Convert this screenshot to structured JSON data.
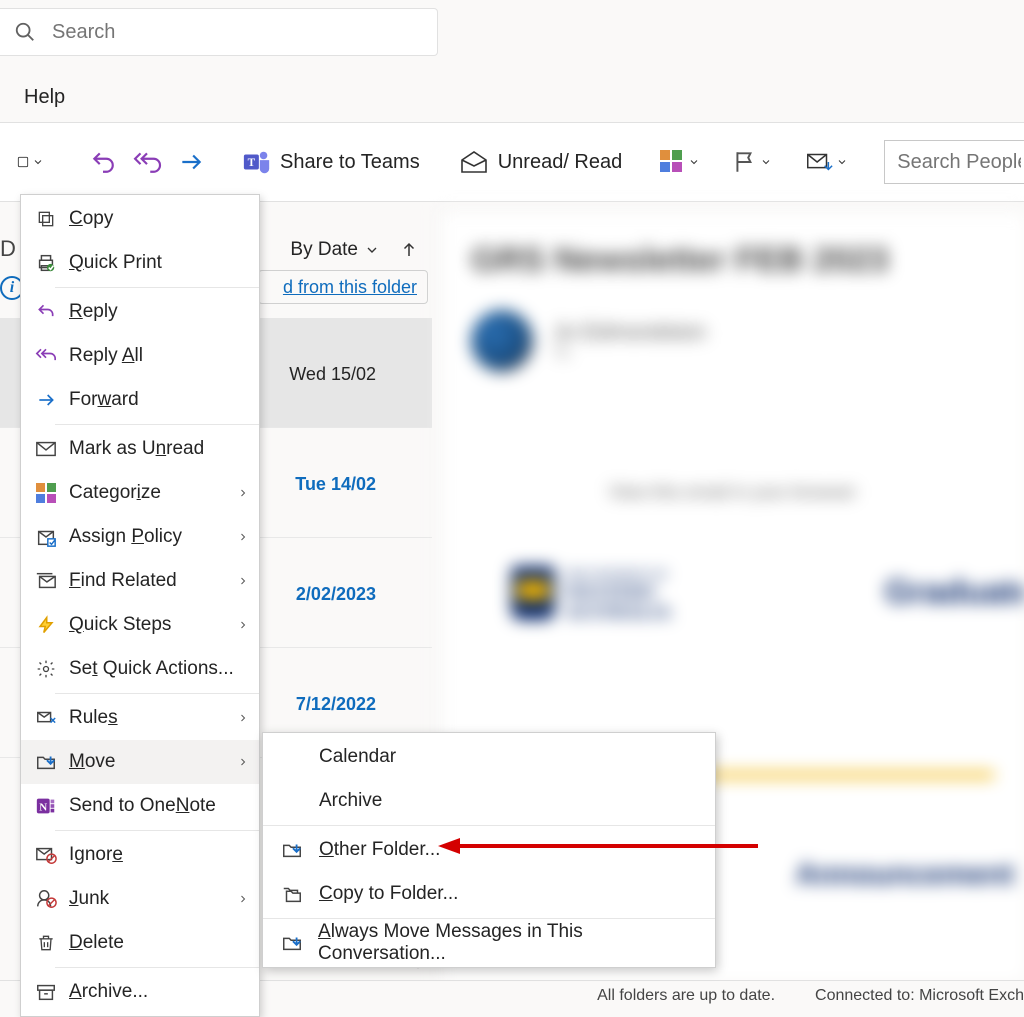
{
  "search": {
    "placeholder": "Search"
  },
  "tabs": {
    "help": "Help"
  },
  "ribbon": {
    "share_to_teams": "Share to Teams",
    "unread_read": "Unread/ Read",
    "search_people_placeholder": "Search People"
  },
  "list_header": {
    "by_date": "By Date",
    "folder_link": "d from this folder"
  },
  "messages": [
    {
      "date": "Wed 15/02",
      "unread": false
    },
    {
      "date": "Tue 14/02",
      "unread": true
    },
    {
      "date": "2/02/2023",
      "unread": true
    },
    {
      "date": "7/12/2022",
      "unread": true
    }
  ],
  "reading": {
    "subject": "GRS Newsletter FEB 2023",
    "from": "Jo Edmondston",
    "to_label": "To",
    "view_in_browser": "View this email in your browser",
    "uwa_line1": "THE UNIVERSITY OF",
    "uwa_line2": "WESTERN",
    "uwa_line3": "AUSTRALIA",
    "graduate": "Graduate",
    "announcements": "Announcement"
  },
  "context_menu": {
    "copy": "Copy",
    "quick_print": "Quick Print",
    "reply": "Reply",
    "reply_all": "Reply All",
    "forward": "Forward",
    "mark_unread": "Mark as Unread",
    "categorize": "Categorize",
    "assign_policy": "Assign Policy",
    "find_related": "Find Related",
    "quick_steps": "Quick Steps",
    "set_quick_actions": "Set Quick Actions...",
    "rules": "Rules",
    "move": "Move",
    "onenote": "Send to OneNote",
    "ignore": "Ignore",
    "junk": "Junk",
    "delete": "Delete",
    "archive": "Archive..."
  },
  "move_submenu": {
    "calendar": "Calendar",
    "archive": "Archive",
    "other_folder": "Other Folder...",
    "copy_to_folder": "Copy to Folder...",
    "always_move": "Always Move Messages in This Conversation..."
  },
  "status_bar": {
    "folders": "All folders are up to date.",
    "connected": "Connected to: Microsoft Exch"
  }
}
